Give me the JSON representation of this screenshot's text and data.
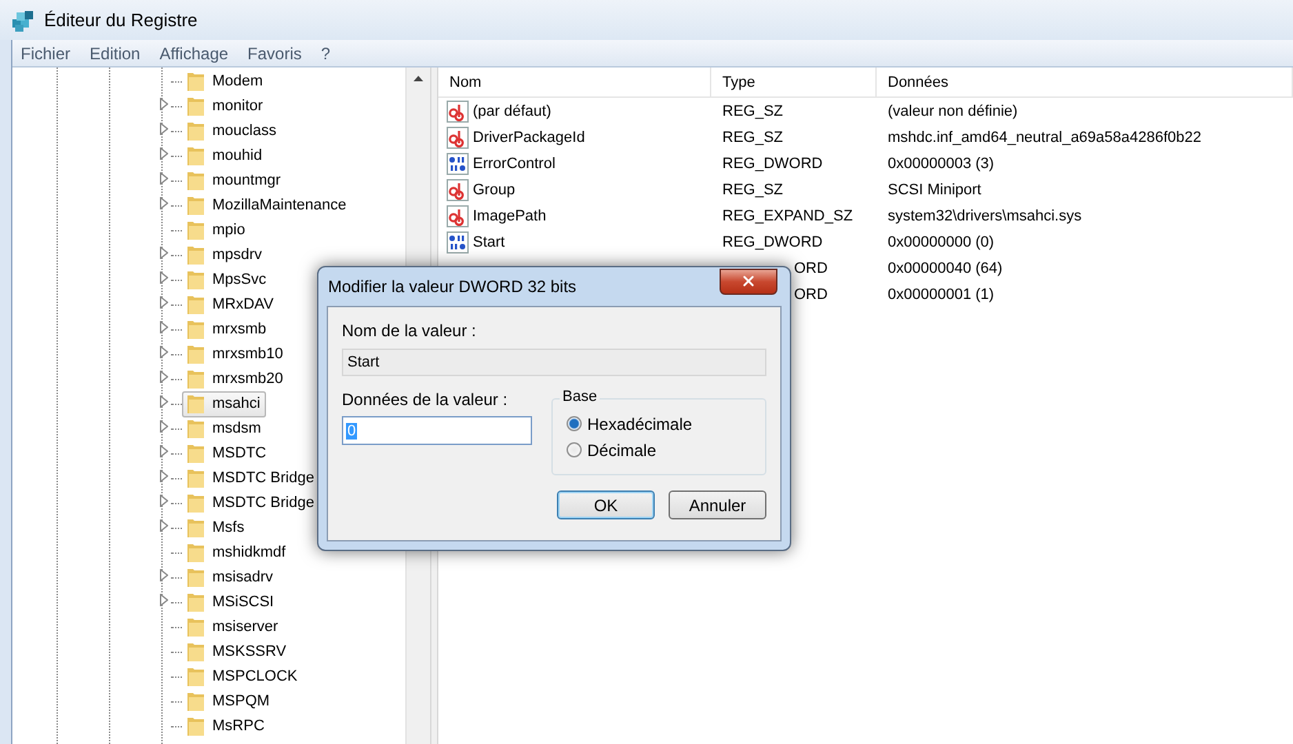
{
  "window": {
    "title": "Éditeur du Registre"
  },
  "menu": [
    "Fichier",
    "Edition",
    "Affichage",
    "Favoris",
    "?"
  ],
  "tree": {
    "items": [
      {
        "label": "Modem",
        "expandable": false,
        "selected": false
      },
      {
        "label": "monitor",
        "expandable": true,
        "selected": false
      },
      {
        "label": "mouclass",
        "expandable": true,
        "selected": false
      },
      {
        "label": "mouhid",
        "expandable": true,
        "selected": false
      },
      {
        "label": "mountmgr",
        "expandable": true,
        "selected": false
      },
      {
        "label": "MozillaMaintenance",
        "expandable": true,
        "selected": false
      },
      {
        "label": "mpio",
        "expandable": false,
        "selected": false
      },
      {
        "label": "mpsdrv",
        "expandable": true,
        "selected": false
      },
      {
        "label": "MpsSvc",
        "expandable": true,
        "selected": false
      },
      {
        "label": "MRxDAV",
        "expandable": true,
        "selected": false
      },
      {
        "label": "mrxsmb",
        "expandable": true,
        "selected": false
      },
      {
        "label": "mrxsmb10",
        "expandable": true,
        "selected": false
      },
      {
        "label": "mrxsmb20",
        "expandable": true,
        "selected": false
      },
      {
        "label": "msahci",
        "expandable": true,
        "selected": true
      },
      {
        "label": "msdsm",
        "expandable": true,
        "selected": false
      },
      {
        "label": "MSDTC",
        "expandable": true,
        "selected": false
      },
      {
        "label": "MSDTC Bridge",
        "expandable": true,
        "selected": false
      },
      {
        "label": "MSDTC Bridge",
        "expandable": true,
        "selected": false
      },
      {
        "label": "Msfs",
        "expandable": true,
        "selected": false
      },
      {
        "label": "mshidkmdf",
        "expandable": false,
        "selected": false
      },
      {
        "label": "msisadrv",
        "expandable": true,
        "selected": false
      },
      {
        "label": "MSiSCSI",
        "expandable": true,
        "selected": false
      },
      {
        "label": "msiserver",
        "expandable": false,
        "selected": false
      },
      {
        "label": "MSKSSRV",
        "expandable": false,
        "selected": false
      },
      {
        "label": "MSPCLOCK",
        "expandable": false,
        "selected": false
      },
      {
        "label": "MSPQM",
        "expandable": false,
        "selected": false
      },
      {
        "label": "MsRPC",
        "expandable": false,
        "selected": false
      }
    ]
  },
  "values": {
    "columns": [
      "Nom",
      "Type",
      "Données"
    ],
    "rows": [
      {
        "kind": "string",
        "name": "(par défaut)",
        "type": "REG_SZ",
        "data": "(valeur non définie)",
        "covered": false
      },
      {
        "kind": "string",
        "name": "DriverPackageId",
        "type": "REG_SZ",
        "data": "mshdc.inf_amd64_neutral_a69a58a4286f0b22",
        "covered": false
      },
      {
        "kind": "binary",
        "name": "ErrorControl",
        "type": "REG_DWORD",
        "data": "0x00000003 (3)",
        "covered": false
      },
      {
        "kind": "string",
        "name": "Group",
        "type": "REG_SZ",
        "data": "SCSI Miniport",
        "covered": false
      },
      {
        "kind": "string",
        "name": "ImagePath",
        "type": "REG_EXPAND_SZ",
        "data": "system32\\drivers\\msahci.sys",
        "covered": false
      },
      {
        "kind": "binary",
        "name": "Start",
        "type": "REG_DWORD",
        "data": "0x00000000 (0)",
        "covered": false
      },
      {
        "kind": "binary",
        "type": "ORD",
        "data": "0x00000040 (64)",
        "covered": true
      },
      {
        "kind": "binary",
        "type": "ORD",
        "data": "0x00000001 (1)",
        "covered": true
      }
    ]
  },
  "dialog": {
    "title": "Modifier la valeur DWORD 32 bits",
    "name_label": "Nom de la valeur :",
    "name_value": "Start",
    "data_label": "Données de la valeur :",
    "data_value": "0",
    "base_label": "Base",
    "bases": [
      {
        "label": "Hexadécimale",
        "selected": true
      },
      {
        "label": "Décimale",
        "selected": false
      }
    ],
    "buttons": [
      {
        "label": "OK",
        "default": true
      },
      {
        "label": "Annuler",
        "default": false
      }
    ]
  }
}
